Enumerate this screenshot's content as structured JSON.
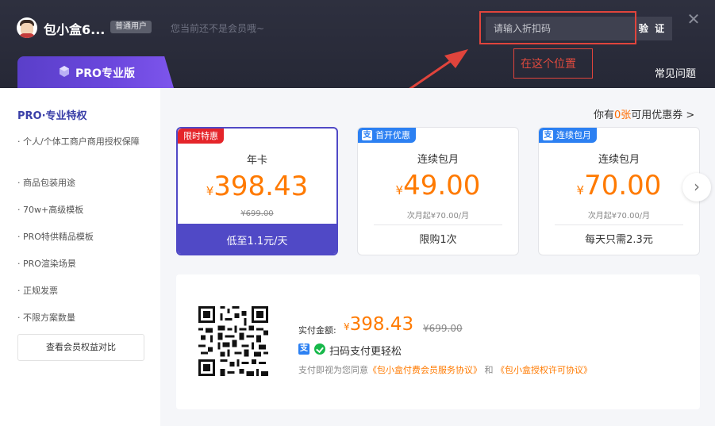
{
  "header": {
    "username": "包小盒6...",
    "user_badge": "普通用户",
    "membership_status": "您当前还不是会员哦~",
    "discount_placeholder": "请输入折扣码",
    "verify_label": "验 证",
    "close_glyph": "✕",
    "faq_label": "常见问题"
  },
  "annotation": {
    "label": "在这个位置",
    "color": "#e0443c"
  },
  "pro_tab": {
    "label": "PRO专业版",
    "color": "#6b47dd"
  },
  "sidebar": {
    "title": "PRO·专业特权",
    "features": [
      "· 个人/个体工商户商用授权保障",
      "· 商品包装用途",
      "· 70w+高级模板",
      "· PRO特供精品模板",
      "· PRO渲染场景",
      "· 正规发票",
      "· 不限方案数量"
    ],
    "compare_button": "查看会员权益对比"
  },
  "coupon": {
    "prefix": "你有",
    "count": "0张",
    "suffix": "可用优惠券 >"
  },
  "plans": [
    {
      "tag": "限时特惠",
      "name": "年卡",
      "currency": "¥",
      "price": "398.43",
      "sub": "¥699.00",
      "footer": "低至1.1元/天",
      "selected": true
    },
    {
      "tag": "首开优惠",
      "name": "连续包月",
      "currency": "¥",
      "price": "49.00",
      "sub": "次月起¥70.00/月",
      "footer": "限购1次",
      "selected": false
    },
    {
      "tag": "连续包月",
      "name": "连续包月",
      "currency": "¥",
      "price": "70.00",
      "sub": "次月起¥70.00/月",
      "footer": "每天只需2.3元",
      "selected": false
    }
  ],
  "payment": {
    "amount_label": "实付金额:",
    "currency": "¥",
    "amount": "398.43",
    "original": "¥699.00",
    "scan_text": "扫码支付更轻松",
    "agreement_prefix": "支付即视为您同意",
    "agreement_link1": "《包小盒付费会员服务协议》",
    "agreement_and": "和",
    "agreement_link2": "《包小盒授权许可协议》"
  },
  "colors": {
    "accent": "#ff7a00",
    "selected": "#5049c6",
    "alipay": "#2c80f2",
    "wechat": "#17b84a",
    "tag_red": "#e5252a"
  }
}
